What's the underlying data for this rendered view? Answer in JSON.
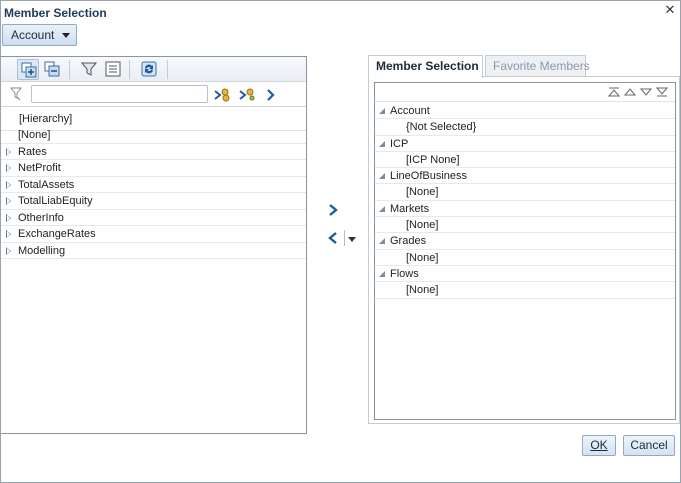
{
  "dialog": {
    "title": "Member Selection"
  },
  "dimension_dropdown": {
    "label": "Account"
  },
  "left": {
    "search": {
      "value": "",
      "placeholder": ""
    },
    "hierarchy_header": "[Hierarchy]",
    "tree": [
      {
        "label": "[None]",
        "expandable": false
      },
      {
        "label": "Rates",
        "expandable": true
      },
      {
        "label": "NetProfit",
        "expandable": true
      },
      {
        "label": "TotalAssets",
        "expandable": true
      },
      {
        "label": "TotalLiabEquity",
        "expandable": true
      },
      {
        "label": "OtherInfo",
        "expandable": true
      },
      {
        "label": "ExchangeRates",
        "expandable": true
      },
      {
        "label": "Modelling",
        "expandable": true
      }
    ]
  },
  "tabs": [
    {
      "label": "Member Selection",
      "active": true
    },
    {
      "label": "Favorite Members",
      "active": false
    }
  ],
  "selection": [
    {
      "dimension": "Account",
      "member": "{Not Selected}"
    },
    {
      "dimension": "ICP",
      "member": "[ICP None]"
    },
    {
      "dimension": "LineOfBusiness",
      "member": "[None]"
    },
    {
      "dimension": "Markets",
      "member": "[None]"
    },
    {
      "dimension": "Grades",
      "member": "[None]"
    },
    {
      "dimension": "Flows",
      "member": "[None]"
    }
  ],
  "buttons": {
    "ok": "OK",
    "cancel": "Cancel"
  },
  "colors": {
    "accent": "#2a6fd0",
    "title": "#1f3a5a",
    "button_border": "#8fa9c7"
  }
}
